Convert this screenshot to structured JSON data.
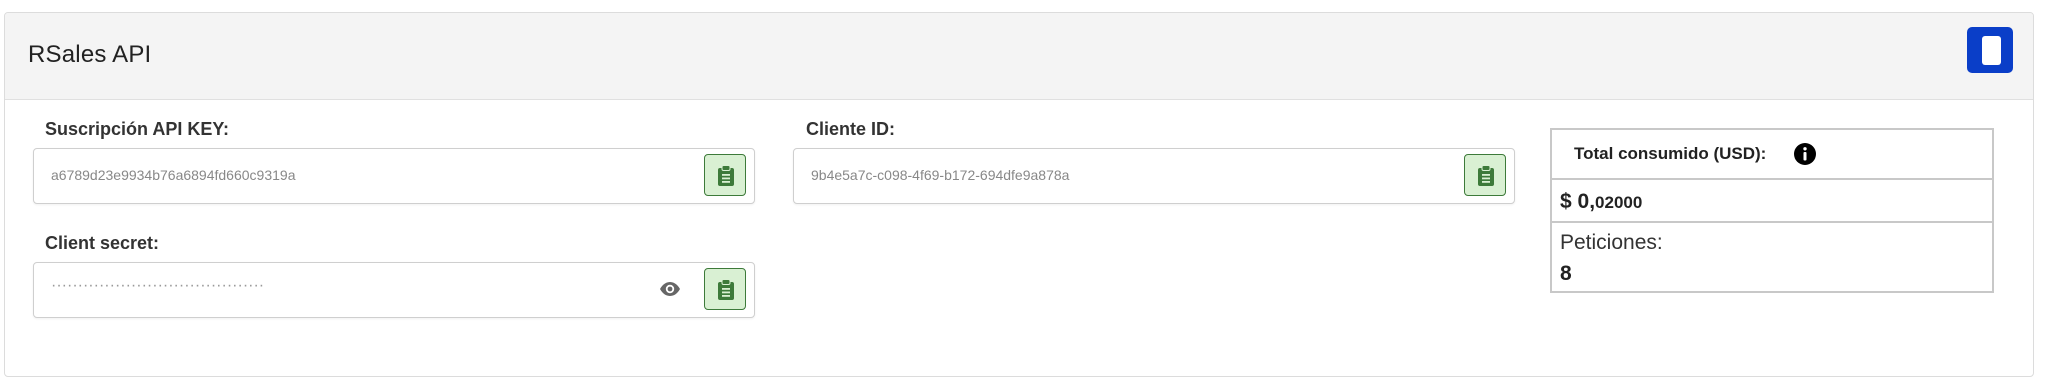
{
  "card": {
    "title": "RSales API"
  },
  "fields": {
    "api_key": {
      "label": "Suscripción API KEY:",
      "value": "a6789d23e9934b76a6894fd660c9319a"
    },
    "client_id": {
      "label": "Cliente ID:",
      "value": "9b4e5a7c-c098-4f69-b172-694dfe9a878a"
    },
    "client_secret": {
      "label": "Client secret:",
      "masked_value": "········································"
    }
  },
  "stats": {
    "total_label": "Total consumido (USD):",
    "currency": "$",
    "cost_integer": "0,",
    "cost_decimal": "02000",
    "requests_label": "Peticiones:",
    "requests_value": "8"
  },
  "colors": {
    "accent_blue": "#0a3ec8",
    "copy_green": "#3d7a3a",
    "copy_green_bg": "#d9f0d3"
  },
  "icons": {
    "copy": "clipboard-icon",
    "eye": "eye-icon",
    "info": "info-icon",
    "toggle": "panel-toggle-icon"
  }
}
